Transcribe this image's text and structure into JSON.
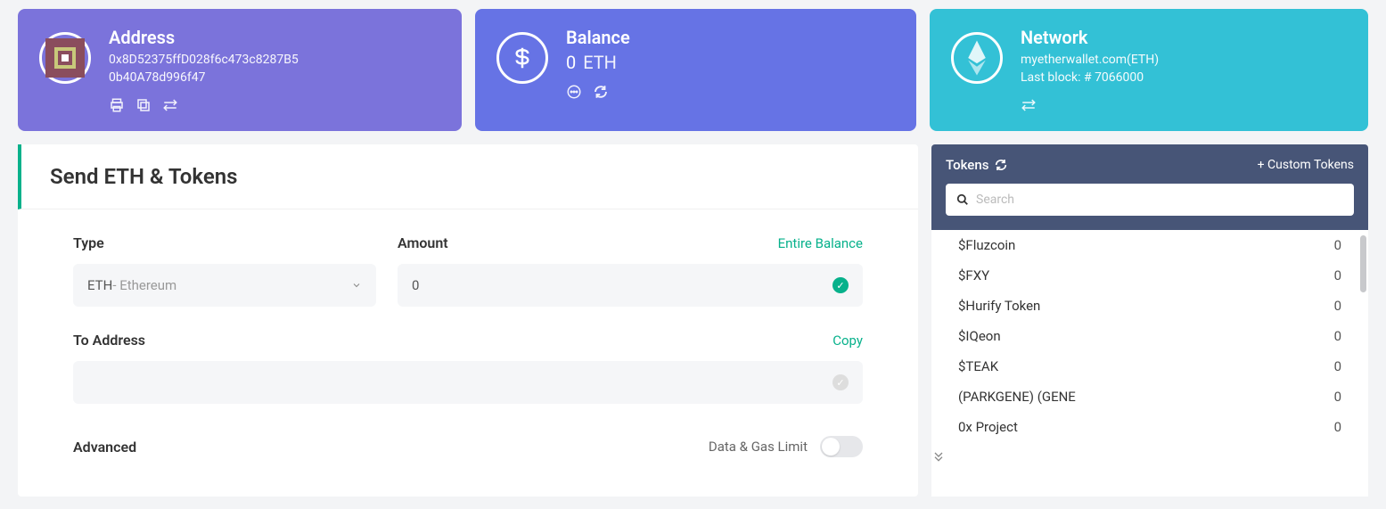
{
  "address": {
    "title": "Address",
    "line1": "0x8D52375ffD028f6c473c8287B5",
    "line2": "0b40A78d996f47"
  },
  "balance": {
    "title": "Balance",
    "value": "0",
    "currency": "ETH"
  },
  "network": {
    "title": "Network",
    "name": "myetherwallet.com(ETH)",
    "lastblock": "Last block: # 7066000"
  },
  "send": {
    "heading": "Send ETH & Tokens",
    "type_label": "Type",
    "type_selected": "ETH",
    "type_selected_sub": " - Ethereum",
    "amount_label": "Amount",
    "entire_balance": "Entire Balance",
    "amount_value": "0",
    "to_label": "To Address",
    "copy": "Copy",
    "to_value": "",
    "advanced": "Advanced",
    "gas_label": "Data & Gas Limit"
  },
  "tokens": {
    "title": "Tokens",
    "custom": "+ Custom Tokens",
    "search_placeholder": "Search",
    "items": [
      {
        "name": "$Fluzcoin",
        "bal": "0"
      },
      {
        "name": "$FXY",
        "bal": "0"
      },
      {
        "name": "$Hurify Token",
        "bal": "0"
      },
      {
        "name": "$IQeon",
        "bal": "0"
      },
      {
        "name": "$TEAK",
        "bal": "0"
      },
      {
        "name": "(PARKGENE) (GENE",
        "bal": "0"
      },
      {
        "name": "0x Project",
        "bal": "0"
      }
    ]
  }
}
